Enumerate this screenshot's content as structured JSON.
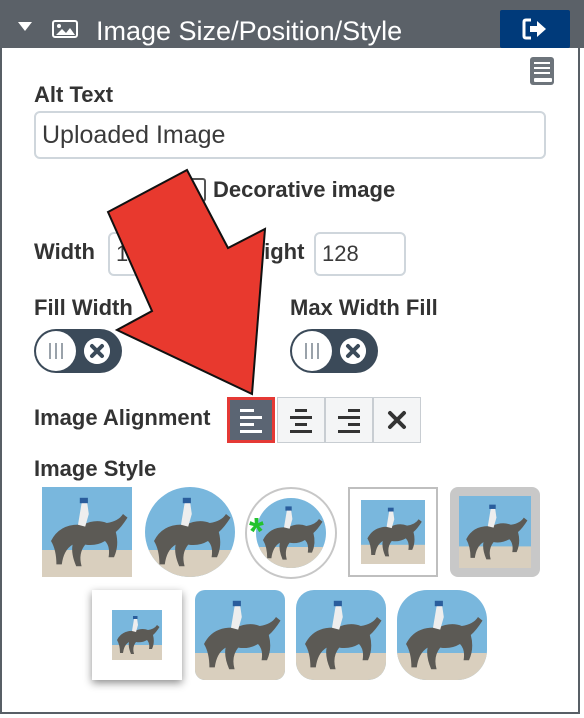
{
  "header": {
    "title": "Image Size/Position/Style",
    "collapse_icon": "caret-down-icon",
    "image_icon": "image-icon",
    "exit_icon": "sign-out-icon"
  },
  "book_icon": "book-icon",
  "alt_text": {
    "label": "Alt Text",
    "value": "Uploaded Image"
  },
  "decorative": {
    "label": "Decorative image",
    "checked": false
  },
  "width": {
    "label": "Width",
    "value": "128"
  },
  "height": {
    "label": "Height",
    "value": "128"
  },
  "fill_width": {
    "label": "Fill Width",
    "on": false
  },
  "max_width_fill": {
    "label": "Max Width Fill",
    "on": false
  },
  "alignment": {
    "label": "Image Alignment",
    "options": [
      "align-left",
      "align-center",
      "align-right",
      "align-none"
    ],
    "selected": "align-left"
  },
  "image_style": {
    "label": "Image Style"
  },
  "colors": {
    "header": "#5b6168",
    "exit_button": "#003a7a",
    "toggle": "#3b4a59",
    "highlight": "#e53935",
    "arrow": "#e8392e",
    "star": "#22c22e"
  }
}
